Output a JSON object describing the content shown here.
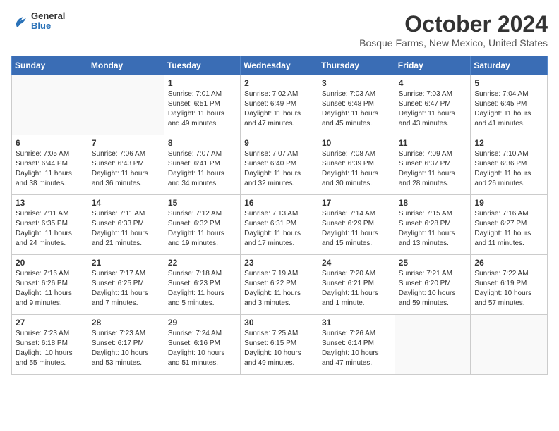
{
  "header": {
    "logo": {
      "line1": "General",
      "line2": "Blue"
    },
    "title": "October 2024",
    "subtitle": "Bosque Farms, New Mexico, United States"
  },
  "weekdays": [
    "Sunday",
    "Monday",
    "Tuesday",
    "Wednesday",
    "Thursday",
    "Friday",
    "Saturday"
  ],
  "weeks": [
    [
      {
        "day": "",
        "empty": true
      },
      {
        "day": "",
        "empty": true
      },
      {
        "day": "1",
        "sunrise": "7:01 AM",
        "sunset": "6:51 PM",
        "daylight": "11 hours and 49 minutes."
      },
      {
        "day": "2",
        "sunrise": "7:02 AM",
        "sunset": "6:49 PM",
        "daylight": "11 hours and 47 minutes."
      },
      {
        "day": "3",
        "sunrise": "7:03 AM",
        "sunset": "6:48 PM",
        "daylight": "11 hours and 45 minutes."
      },
      {
        "day": "4",
        "sunrise": "7:03 AM",
        "sunset": "6:47 PM",
        "daylight": "11 hours and 43 minutes."
      },
      {
        "day": "5",
        "sunrise": "7:04 AM",
        "sunset": "6:45 PM",
        "daylight": "11 hours and 41 minutes."
      }
    ],
    [
      {
        "day": "6",
        "sunrise": "7:05 AM",
        "sunset": "6:44 PM",
        "daylight": "11 hours and 38 minutes."
      },
      {
        "day": "7",
        "sunrise": "7:06 AM",
        "sunset": "6:43 PM",
        "daylight": "11 hours and 36 minutes."
      },
      {
        "day": "8",
        "sunrise": "7:07 AM",
        "sunset": "6:41 PM",
        "daylight": "11 hours and 34 minutes."
      },
      {
        "day": "9",
        "sunrise": "7:07 AM",
        "sunset": "6:40 PM",
        "daylight": "11 hours and 32 minutes."
      },
      {
        "day": "10",
        "sunrise": "7:08 AM",
        "sunset": "6:39 PM",
        "daylight": "11 hours and 30 minutes."
      },
      {
        "day": "11",
        "sunrise": "7:09 AM",
        "sunset": "6:37 PM",
        "daylight": "11 hours and 28 minutes."
      },
      {
        "day": "12",
        "sunrise": "7:10 AM",
        "sunset": "6:36 PM",
        "daylight": "11 hours and 26 minutes."
      }
    ],
    [
      {
        "day": "13",
        "sunrise": "7:11 AM",
        "sunset": "6:35 PM",
        "daylight": "11 hours and 24 minutes."
      },
      {
        "day": "14",
        "sunrise": "7:11 AM",
        "sunset": "6:33 PM",
        "daylight": "11 hours and 21 minutes."
      },
      {
        "day": "15",
        "sunrise": "7:12 AM",
        "sunset": "6:32 PM",
        "daylight": "11 hours and 19 minutes."
      },
      {
        "day": "16",
        "sunrise": "7:13 AM",
        "sunset": "6:31 PM",
        "daylight": "11 hours and 17 minutes."
      },
      {
        "day": "17",
        "sunrise": "7:14 AM",
        "sunset": "6:29 PM",
        "daylight": "11 hours and 15 minutes."
      },
      {
        "day": "18",
        "sunrise": "7:15 AM",
        "sunset": "6:28 PM",
        "daylight": "11 hours and 13 minutes."
      },
      {
        "day": "19",
        "sunrise": "7:16 AM",
        "sunset": "6:27 PM",
        "daylight": "11 hours and 11 minutes."
      }
    ],
    [
      {
        "day": "20",
        "sunrise": "7:16 AM",
        "sunset": "6:26 PM",
        "daylight": "11 hours and 9 minutes."
      },
      {
        "day": "21",
        "sunrise": "7:17 AM",
        "sunset": "6:25 PM",
        "daylight": "11 hours and 7 minutes."
      },
      {
        "day": "22",
        "sunrise": "7:18 AM",
        "sunset": "6:23 PM",
        "daylight": "11 hours and 5 minutes."
      },
      {
        "day": "23",
        "sunrise": "7:19 AM",
        "sunset": "6:22 PM",
        "daylight": "11 hours and 3 minutes."
      },
      {
        "day": "24",
        "sunrise": "7:20 AM",
        "sunset": "6:21 PM",
        "daylight": "11 hours and 1 minute."
      },
      {
        "day": "25",
        "sunrise": "7:21 AM",
        "sunset": "6:20 PM",
        "daylight": "10 hours and 59 minutes."
      },
      {
        "day": "26",
        "sunrise": "7:22 AM",
        "sunset": "6:19 PM",
        "daylight": "10 hours and 57 minutes."
      }
    ],
    [
      {
        "day": "27",
        "sunrise": "7:23 AM",
        "sunset": "6:18 PM",
        "daylight": "10 hours and 55 minutes."
      },
      {
        "day": "28",
        "sunrise": "7:23 AM",
        "sunset": "6:17 PM",
        "daylight": "10 hours and 53 minutes."
      },
      {
        "day": "29",
        "sunrise": "7:24 AM",
        "sunset": "6:16 PM",
        "daylight": "10 hours and 51 minutes."
      },
      {
        "day": "30",
        "sunrise": "7:25 AM",
        "sunset": "6:15 PM",
        "daylight": "10 hours and 49 minutes."
      },
      {
        "day": "31",
        "sunrise": "7:26 AM",
        "sunset": "6:14 PM",
        "daylight": "10 hours and 47 minutes."
      },
      {
        "day": "",
        "empty": true
      },
      {
        "day": "",
        "empty": true
      }
    ]
  ],
  "labels": {
    "sunrise": "Sunrise:",
    "sunset": "Sunset:",
    "daylight": "Daylight:"
  }
}
